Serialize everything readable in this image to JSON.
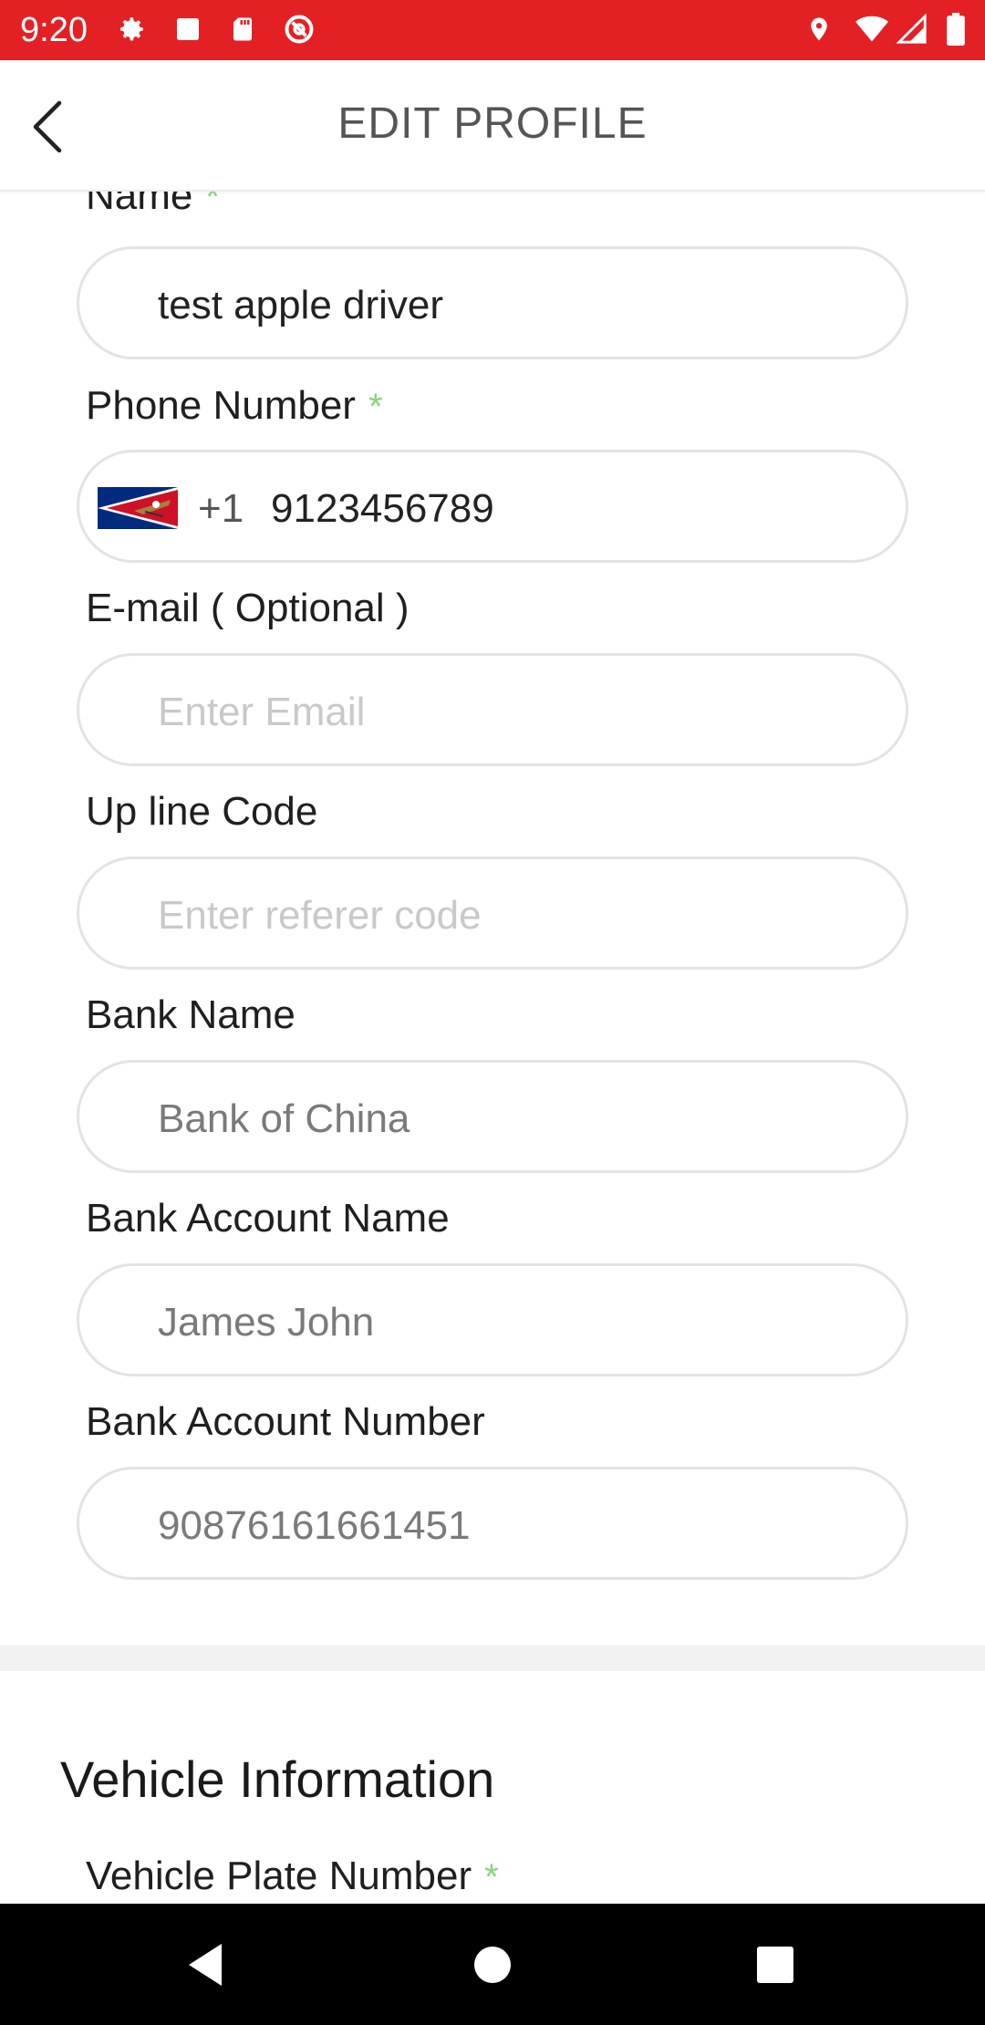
{
  "status_bar": {
    "time": "9:20",
    "background": "#e32125",
    "left_icons": [
      "gear-icon",
      "square-icon",
      "sd-card-icon",
      "at-sign-icon"
    ],
    "right_icons": [
      "location-pin-icon",
      "wifi-icon",
      "cell-signal-icon",
      "battery-icon"
    ]
  },
  "header": {
    "title": "EDIT PROFILE",
    "back_icon": "chevron-left-icon"
  },
  "form": {
    "name": {
      "label": "Name",
      "required_mark": "*",
      "value": "test apple driver"
    },
    "phone": {
      "label": "Phone Number",
      "required_mark": "*",
      "flag": "american-samoa-flag",
      "dial_code": "+1",
      "value": "9123456789"
    },
    "email": {
      "label": "E-mail ( Optional )",
      "value": "",
      "placeholder": "Enter Email"
    },
    "upline": {
      "label": "Up line Code",
      "value": "",
      "placeholder": "Enter referer code"
    },
    "bank_name": {
      "label": "Bank Name",
      "value": "Bank of China"
    },
    "bank_account_name": {
      "label": "Bank Account Name",
      "value": "James John"
    },
    "bank_account_number": {
      "label": "Bank Account Number",
      "value": "90876161661451"
    }
  },
  "vehicle_section": {
    "title": "Vehicle Information",
    "plate": {
      "label": "Vehicle Plate Number",
      "required_mark": "*"
    }
  },
  "nav_bar": {
    "buttons": [
      "back-triangle-icon",
      "home-circle-icon",
      "recents-square-icon"
    ]
  },
  "colors": {
    "accent_red": "#e32125",
    "required_green": "#8cd37f",
    "border_gray": "#e3e3e3",
    "placeholder_gray": "#c9c9c9"
  }
}
